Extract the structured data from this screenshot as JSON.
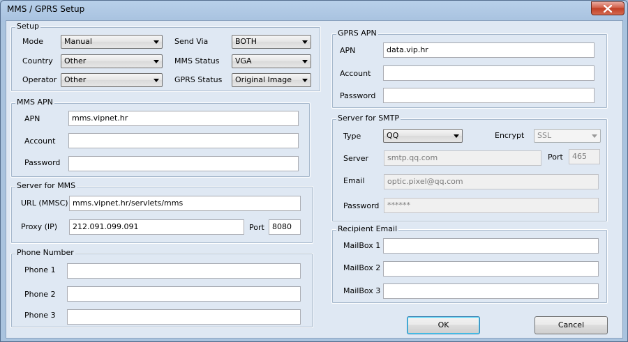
{
  "window": {
    "title": "MMS / GPRS Setup"
  },
  "setup": {
    "title": "Setup",
    "mode_label": "Mode",
    "mode_value": "Manual",
    "country_label": "Country",
    "country_value": "Other",
    "operator_label": "Operator",
    "operator_value": "Other",
    "send_via_label": "Send Via",
    "send_via_value": "BOTH",
    "mms_status_label": "MMS Status",
    "mms_status_value": "VGA",
    "gprs_status_label": "GPRS Status",
    "gprs_status_value": "Original Image"
  },
  "mms_apn": {
    "title": "MMS APN",
    "apn_label": "APN",
    "apn_value": "mms.vipnet.hr",
    "account_label": "Account",
    "account_value": "",
    "password_label": "Password",
    "password_value": ""
  },
  "server_mms": {
    "title": "Server for MMS",
    "url_label": "URL (MMSC)",
    "url_value": "mms.vipnet.hr/servlets/mms",
    "proxy_label": "Proxy (IP)",
    "proxy_value": "212.091.099.091",
    "port_label": "Port",
    "port_value": "8080"
  },
  "phone": {
    "title": "Phone Number",
    "phone1_label": "Phone 1",
    "phone1_value": "",
    "phone2_label": "Phone 2",
    "phone2_value": "",
    "phone3_label": "Phone 3",
    "phone3_value": ""
  },
  "gprs_apn": {
    "title": "GPRS APN",
    "apn_label": "APN",
    "apn_value": "data.vip.hr",
    "account_label": "Account",
    "account_value": "",
    "password_label": "Password",
    "password_value": ""
  },
  "smtp": {
    "title": "Server for SMTP",
    "type_label": "Type",
    "type_value": "QQ",
    "encrypt_label": "Encrypt",
    "encrypt_value": "SSL",
    "server_label": "Server",
    "server_value": "smtp.qq.com",
    "port_label": "Port",
    "port_value": "465",
    "email_label": "Email",
    "email_value": "optic.pixel@qq.com",
    "password_label": "Password",
    "password_value": "******"
  },
  "recipient": {
    "title": "Recipient Email",
    "mailbox1_label": "MailBox 1",
    "mailbox1_value": "",
    "mailbox2_label": "MailBox 2",
    "mailbox2_value": "",
    "mailbox3_label": "MailBox 3",
    "mailbox3_value": ""
  },
  "buttons": {
    "ok": "OK",
    "cancel": "Cancel"
  },
  "icons": {
    "close": "close-icon"
  }
}
